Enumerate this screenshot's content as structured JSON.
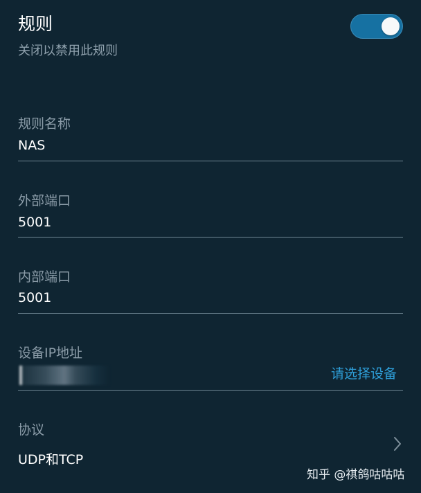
{
  "rule": {
    "title": "规则",
    "subtitle": "关闭以禁用此规则",
    "enabled": true
  },
  "fields": {
    "name": {
      "label": "规则名称",
      "value": "NAS"
    },
    "external_port": {
      "label": "外部端口",
      "value": "5001"
    },
    "internal_port": {
      "label": "内部端口",
      "value": "5001"
    },
    "device_ip": {
      "label": "设备IP地址",
      "action_label": "请选择设备"
    },
    "protocol": {
      "label": "协议",
      "value": "UDP和TCP"
    }
  },
  "watermark": "知乎 @祺鸽咕咕咕",
  "colors": {
    "background": "#0f2532",
    "accent": "#2e9ed8",
    "toggle_on": "#1671a2"
  },
  "icons": {
    "protocol_chevron": "chevron-right-icon"
  }
}
